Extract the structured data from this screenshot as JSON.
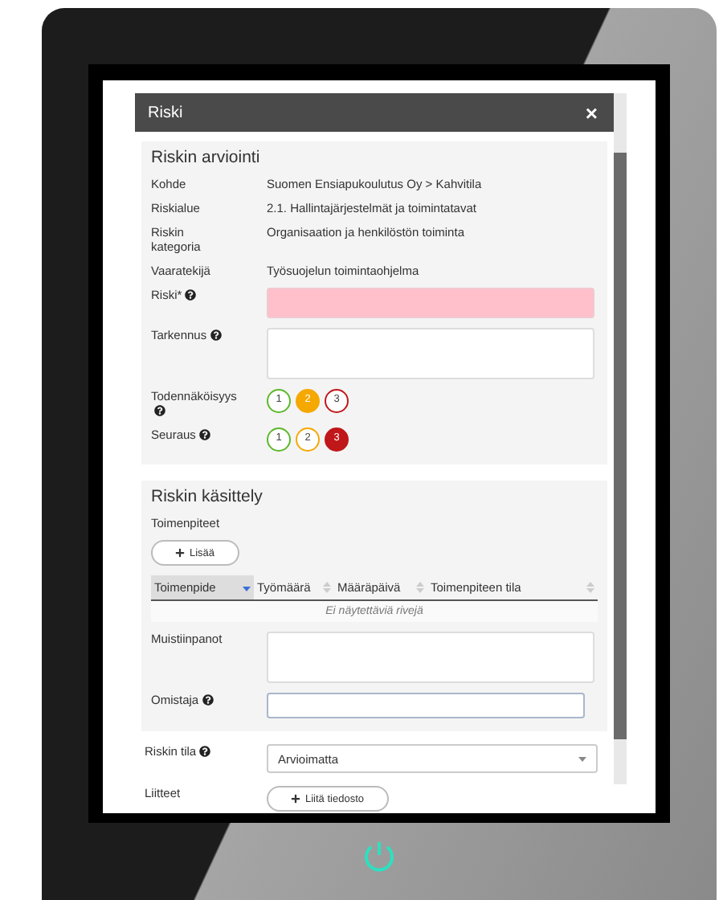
{
  "dialog": {
    "title": "Riski",
    "close": "×"
  },
  "assessment": {
    "heading": "Riskin arviointi",
    "info_rows": [
      {
        "label": "Kohde",
        "value": "Suomen Ensiapukoulutus Oy > Kahvitila"
      },
      {
        "label": "Riskialue",
        "value": "2.1. Hallintajärjestelmät ja toimintatavat"
      },
      {
        "label": "Riskin kategoria",
        "value": "Organisaation ja henkilöstön toiminta"
      },
      {
        "label": "Vaaratekijä",
        "value": "Työsuojelun toimintaohjelma"
      }
    ],
    "fields": [
      {
        "label": "Riski*",
        "help": true,
        "invalid": true,
        "kind": "single"
      },
      {
        "label": "Tarkennus",
        "help": true,
        "invalid": false,
        "kind": "multi"
      }
    ],
    "ratings": [
      {
        "label": "Todennäköisyys",
        "help": true,
        "options": [
          {
            "text": "1",
            "color": "#5cb82a",
            "selected": false
          },
          {
            "text": "2",
            "color": "#f5a800",
            "selected": true
          },
          {
            "text": "3",
            "color": "#c0171a",
            "selected": false
          }
        ]
      },
      {
        "label": "Seuraus",
        "help": true,
        "options": [
          {
            "text": "1",
            "color": "#5cb82a",
            "selected": false
          },
          {
            "text": "2",
            "color": "#f5a800",
            "selected": false
          },
          {
            "text": "3",
            "color": "#c0171a",
            "selected": true
          }
        ]
      }
    ]
  },
  "treatment": {
    "heading": "Riskin käsittely",
    "subheading": "Toimenpiteet",
    "add_button": "Lisää",
    "columns": [
      {
        "label": "Toimenpide",
        "sorted": true
      },
      {
        "label": "Työmäärä",
        "sorted": false
      },
      {
        "label": "Määräpäivä",
        "sorted": false
      },
      {
        "label": "Toimenpiteen tila",
        "sorted": false
      }
    ],
    "empty_text": "Ei näytettäviä rivejä",
    "fields": [
      {
        "label": "Muistiinpanot",
        "help": false,
        "kind": "multi"
      },
      {
        "label": "Omistaja",
        "help": true,
        "kind": "single"
      }
    ]
  },
  "status": {
    "label": "Riskin tila",
    "help": true,
    "value": "Arvioimatta"
  },
  "attachments": {
    "label": "Liitteet",
    "button": "Liitä tiedosto"
  }
}
